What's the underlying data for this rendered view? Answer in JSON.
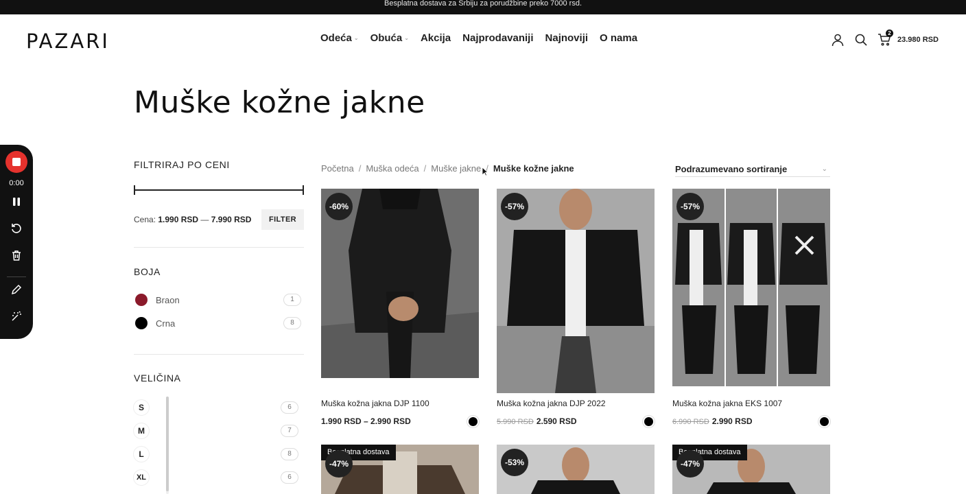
{
  "topbar": {
    "text": "Besplatna dostava za Srbiju za porudžbine preko 7000 rsd."
  },
  "header": {
    "logo": "PAZARI",
    "nav": [
      {
        "label": "Odeća",
        "has_dropdown": true
      },
      {
        "label": "Obuća",
        "has_dropdown": true
      },
      {
        "label": "Akcija",
        "has_dropdown": false
      },
      {
        "label": "Najprodavaniji",
        "has_dropdown": false
      },
      {
        "label": "Najnoviji",
        "has_dropdown": false
      },
      {
        "label": "O nama",
        "has_dropdown": false
      }
    ],
    "icons": [
      "user-icon",
      "search-icon",
      "cart-icon"
    ],
    "cart_count": "2",
    "cart_total": "23.980 RSD"
  },
  "page": {
    "title": "Muške kožne jakne"
  },
  "recorder": {
    "time": "0:00",
    "icons": [
      "stop-icon",
      "pause-icon",
      "restart-icon",
      "trash-icon",
      "pencil-icon",
      "magic-wand-icon"
    ],
    "stop_color": "#e5322d"
  },
  "filters": {
    "price": {
      "title": "FILTRIRAJ PO CENI",
      "label": "Cena:",
      "min": "1.990 RSD",
      "dash": "—",
      "max": "7.990 RSD",
      "button": "FILTER"
    },
    "color": {
      "title": "BOJA",
      "items": [
        {
          "label": "Braon",
          "count": "1",
          "color": "#8b1a2b"
        },
        {
          "label": "Crna",
          "count": "8",
          "color": "#000000"
        }
      ]
    },
    "size": {
      "title": "VELIČINA",
      "items": [
        {
          "label": "S",
          "count": "6"
        },
        {
          "label": "M",
          "count": "7"
        },
        {
          "label": "L",
          "count": "8"
        },
        {
          "label": "XL",
          "count": "6"
        }
      ]
    }
  },
  "breadcrumb": {
    "items": [
      "Početna",
      "Muška odeća",
      "Muške jakne"
    ],
    "current": "Muške kožne jakne",
    "separator": "/"
  },
  "sort": {
    "selected": "Podrazumevano sortiranje"
  },
  "products": [
    {
      "name": "Muška kožna jakna DJP 1100",
      "price": "1.990 RSD – 2.990 RSD",
      "old_price": "",
      "discount": "-60%",
      "badge": "",
      "swatch": "#000000"
    },
    {
      "name": "Muška kožna jakna DJP 2022",
      "price": "2.590 RSD",
      "old_price": "5.990 RSD",
      "discount": "-57%",
      "badge": "",
      "swatch": "#000000"
    },
    {
      "name": "Muška kožna jakna EKS 1007",
      "price": "2.990 RSD",
      "old_price": "6.990 RSD",
      "discount": "-57%",
      "badge": "",
      "swatch": "#000000"
    },
    {
      "name": "",
      "price": "",
      "old_price": "",
      "discount": "-47%",
      "badge": "Besplatna dostava"
    },
    {
      "name": "",
      "price": "",
      "old_price": "",
      "discount": "-53%",
      "badge": ""
    },
    {
      "name": "",
      "price": "",
      "old_price": "",
      "discount": "-47%",
      "badge": "Besplatna dostava"
    }
  ]
}
